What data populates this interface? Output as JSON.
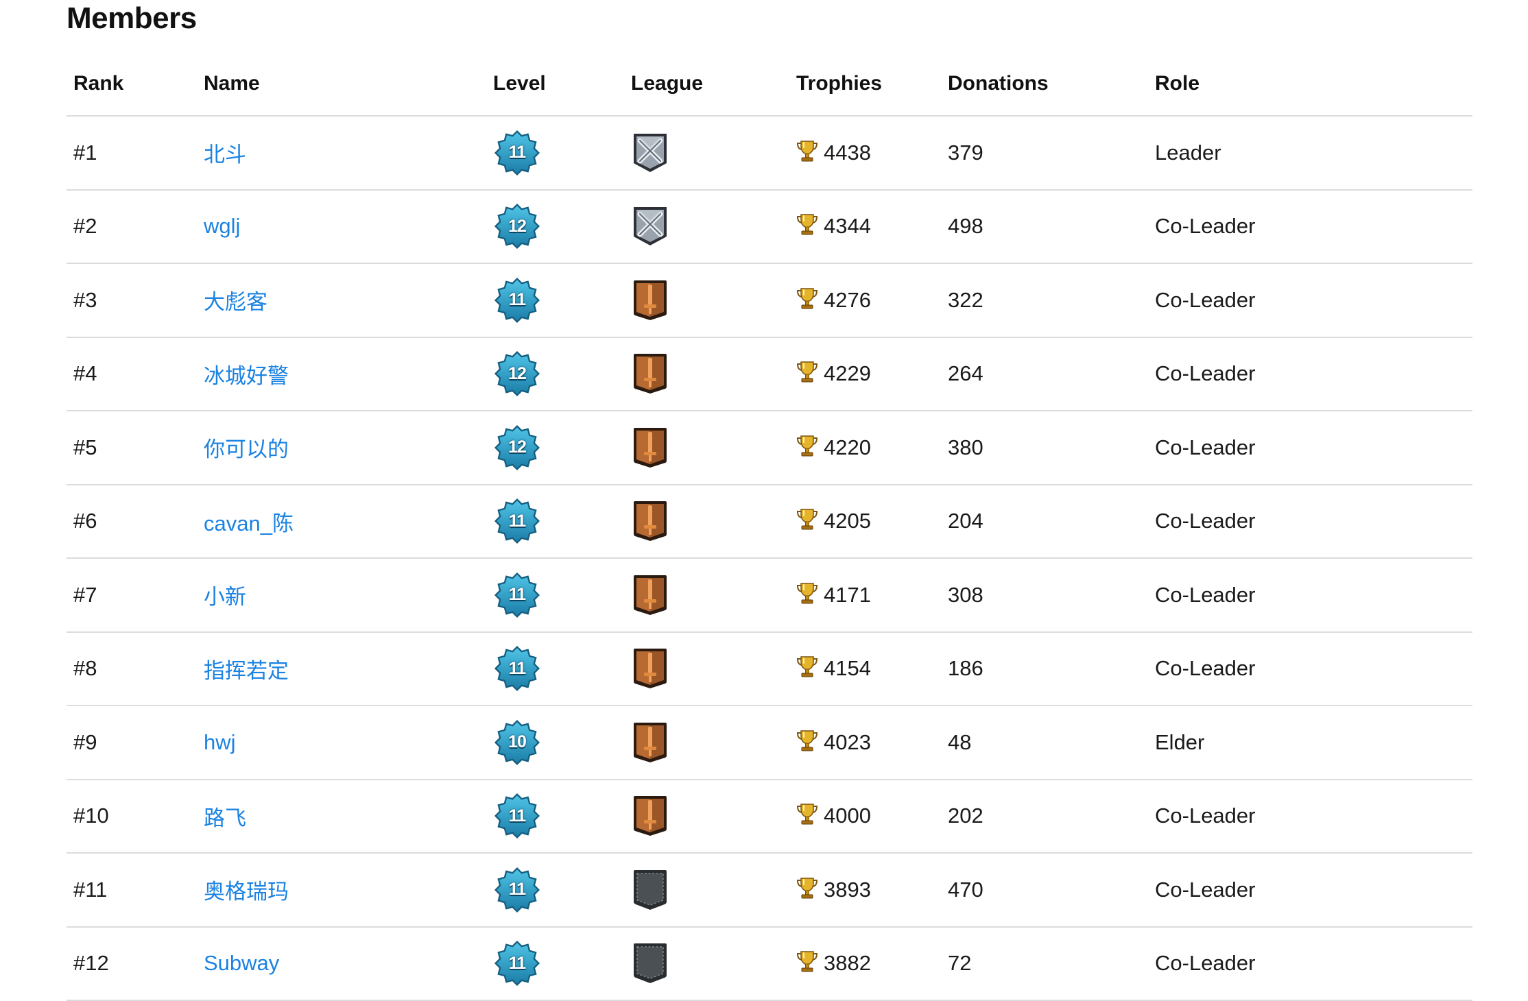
{
  "section_title": "Members",
  "columns": {
    "rank": "Rank",
    "name": "Name",
    "level": "Level",
    "league": "League",
    "trophies": "Trophies",
    "donations": "Donations",
    "role": "Role"
  },
  "members": [
    {
      "rank": "#1",
      "name": "北斗",
      "level": "11",
      "league": "crystal-league-icon",
      "trophies": "4438",
      "donations": "379",
      "role": "Leader"
    },
    {
      "rank": "#2",
      "name": "wglj",
      "level": "12",
      "league": "crystal-league-icon",
      "trophies": "4344",
      "donations": "498",
      "role": "Co-Leader"
    },
    {
      "rank": "#3",
      "name": "大彪客",
      "level": "11",
      "league": "bronze-league-icon",
      "trophies": "4276",
      "donations": "322",
      "role": "Co-Leader"
    },
    {
      "rank": "#4",
      "name": "冰城好警",
      "level": "12",
      "league": "bronze-league-icon",
      "trophies": "4229",
      "donations": "264",
      "role": "Co-Leader"
    },
    {
      "rank": "#5",
      "name": "你可以的",
      "level": "12",
      "league": "bronze-league-icon",
      "trophies": "4220",
      "donations": "380",
      "role": "Co-Leader"
    },
    {
      "rank": "#6",
      "name": "cavan_陈",
      "level": "11",
      "league": "bronze-league-icon",
      "trophies": "4205",
      "donations": "204",
      "role": "Co-Leader"
    },
    {
      "rank": "#7",
      "name": "小新",
      "level": "11",
      "league": "bronze-league-icon",
      "trophies": "4171",
      "donations": "308",
      "role": "Co-Leader"
    },
    {
      "rank": "#8",
      "name": "指挥若定",
      "level": "11",
      "league": "bronze-league-icon",
      "trophies": "4154",
      "donations": "186",
      "role": "Co-Leader"
    },
    {
      "rank": "#9",
      "name": "hwj",
      "level": "10",
      "league": "bronze-league-icon",
      "trophies": "4023",
      "donations": "48",
      "role": "Elder"
    },
    {
      "rank": "#10",
      "name": "路飞",
      "level": "11",
      "league": "bronze-league-icon",
      "trophies": "4000",
      "donations": "202",
      "role": "Co-Leader"
    },
    {
      "rank": "#11",
      "name": "奥格瑞玛",
      "level": "11",
      "league": "unranked-league-icon",
      "trophies": "3893",
      "donations": "470",
      "role": "Co-Leader"
    },
    {
      "rank": "#12",
      "name": "Subway",
      "level": "11",
      "league": "unranked-league-icon",
      "trophies": "3882",
      "donations": "72",
      "role": "Co-Leader"
    }
  ],
  "colors": {
    "link": "#1a82e2",
    "divider": "#dcdcdc",
    "level_badge": "#2a9fc9",
    "bronze_league": "#8a4a22",
    "crystal_league": "#7e8794",
    "unranked_league": "#3b4042",
    "trophy": "#d8a21c"
  }
}
